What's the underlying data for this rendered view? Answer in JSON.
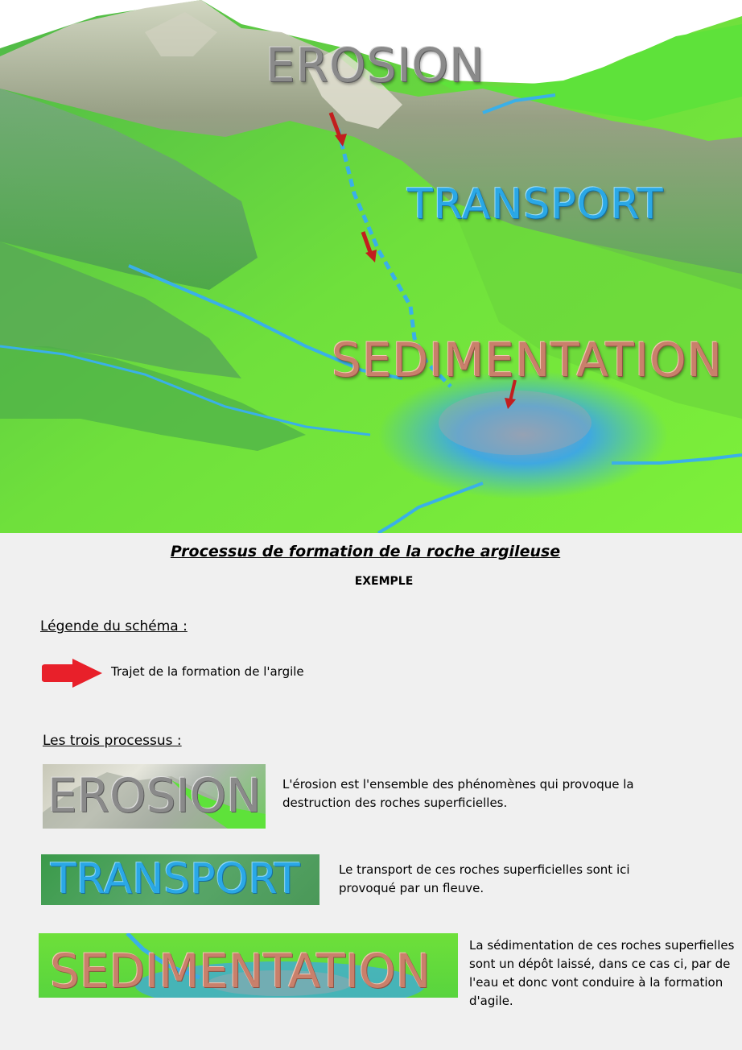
{
  "scene": {
    "labels": {
      "erosion": "EROSION",
      "transport": "TRANSPORT",
      "sedimentation": "SEDIMENTATION"
    },
    "colors": {
      "terrain_green": "#5ed83a",
      "mountain_grey": "#9a9a8a",
      "river_blue": "#3ab0e8",
      "arrow_red": "#c21e1e"
    }
  },
  "title": "Processus de formation de la roche argileuse",
  "subtitle": "EXEMPLE",
  "legend": {
    "heading": "Légende du schéma :",
    "arrow_icon": "red-arrow-icon",
    "arrow_label": "Trajet de la formation de l'argile"
  },
  "processes": {
    "heading": "Les trois processus :",
    "items": [
      {
        "name": "EROSION",
        "description_lines": [
          "L'érosion est l'ensemble des phénomènes qui provoque la",
          "destruction des roches superficielles."
        ]
      },
      {
        "name": "TRANSPORT",
        "description_lines": [
          "Le transport de ces roches superficielles sont ici",
          "provoqué par un fleuve."
        ]
      },
      {
        "name": "SEDIMENTATION",
        "description_lines": [
          "La sédimentation de ces roches superfielles",
          "sont un dépôt laissé, dans ce cas ci, par de",
          "l'eau et donc vont conduire à la formation",
          "d'agile."
        ]
      }
    ]
  }
}
